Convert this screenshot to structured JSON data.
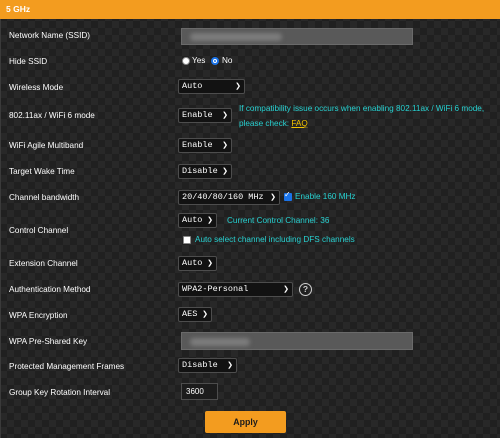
{
  "section_title": "5 GHz",
  "fields": {
    "ssid": {
      "label": "Network Name (SSID)",
      "value": ""
    },
    "hide_ssid": {
      "label": "Hide SSID",
      "yes": "Yes",
      "no": "No",
      "selected": "No"
    },
    "wireless_mode": {
      "label": "Wireless Mode",
      "value": "Auto"
    },
    "wifi6": {
      "label": "802.11ax / WiFi 6 mode",
      "value": "Enable",
      "note_line1": "If compatibility issue occurs when enabling 802.11ax / WiFi 6 mode,",
      "note_line2": "please check: ",
      "note_link": "FAQ"
    },
    "agile_multiband": {
      "label": "WiFi Agile Multiband",
      "value": "Enable"
    },
    "target_wake_time": {
      "label": "Target Wake Time",
      "value": "Disable"
    },
    "channel_bandwidth": {
      "label": "Channel bandwidth",
      "value": "20/40/80/160 MHz",
      "checkbox_label": "Enable 160 MHz",
      "checked": true
    },
    "control_channel": {
      "label": "Control Channel",
      "value": "Auto",
      "current": "Current Control Channel: 36",
      "dfs_label": "Auto select channel including DFS channels",
      "dfs_checked": false
    },
    "extension_channel": {
      "label": "Extension Channel",
      "value": "Auto"
    },
    "auth_method": {
      "label": "Authentication Method",
      "value": "WPA2-Personal",
      "help": "?"
    },
    "wpa_encryption": {
      "label": "WPA Encryption",
      "value": "AES"
    },
    "wpa_psk": {
      "label": "WPA Pre-Shared Key",
      "value": ""
    },
    "pmf": {
      "label": "Protected Management Frames",
      "value": "Disable"
    },
    "group_key": {
      "label": "Group Key Rotation Interval",
      "value": "3600"
    }
  },
  "icons": {
    "chevron": "chevron-down-icon",
    "help": "help-circle-icon",
    "check": "check-icon"
  },
  "colors": {
    "accent": "#f39c1f",
    "note": "#27d2d2",
    "link": "#f2c200",
    "control_blue": "#1a73e8"
  },
  "apply_label": "Apply"
}
